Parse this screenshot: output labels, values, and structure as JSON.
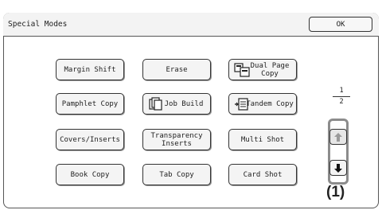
{
  "header": {
    "title": "Special Modes",
    "ok_label": "OK"
  },
  "buttons": [
    {
      "label": "Margin Shift"
    },
    {
      "label": "Erase"
    },
    {
      "label": "Dual Page Copy",
      "icon": "dual-page-copy-icon"
    },
    {
      "label": "Pamphlet Copy"
    },
    {
      "label": "Job Build",
      "icon": "job-build-icon"
    },
    {
      "label": "Tandem Copy",
      "icon": "tandem-copy-icon"
    },
    {
      "label": "Covers/Inserts"
    },
    {
      "label": "Transparency Inserts"
    },
    {
      "label": "Multi Shot"
    },
    {
      "label": "Book Copy"
    },
    {
      "label": "Tab Copy"
    },
    {
      "label": "Card Shot"
    }
  ],
  "pagination": {
    "current": "1",
    "total": "2"
  },
  "scroll": {
    "up_icon": "arrow-up-icon",
    "down_icon": "arrow-down-icon"
  },
  "callout": {
    "label": "(1)"
  }
}
